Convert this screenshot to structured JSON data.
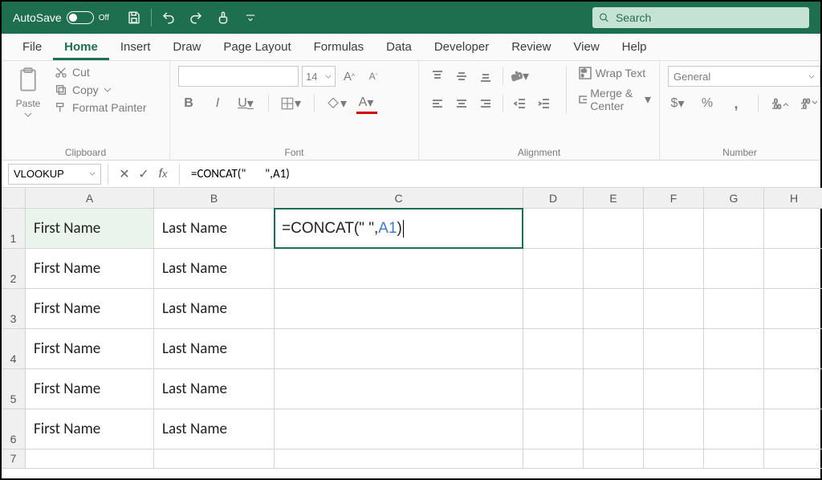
{
  "titlebar": {
    "autosave": "AutoSave",
    "toggle": "Off"
  },
  "search": {
    "placeholder": "Search"
  },
  "tabs": [
    "File",
    "Home",
    "Insert",
    "Draw",
    "Page Layout",
    "Formulas",
    "Data",
    "Developer",
    "Review",
    "View",
    "Help"
  ],
  "active_tab": "Home",
  "ribbon": {
    "clipboard": {
      "label": "Clipboard",
      "paste": "Paste",
      "cut": "Cut",
      "copy": "Copy",
      "format_painter": "Format Painter"
    },
    "font": {
      "label": "Font",
      "font_name": "",
      "font_size": "14",
      "bold": "B",
      "italic": "I",
      "underline": "U"
    },
    "alignment": {
      "label": "Alignment",
      "wrap": "Wrap Text",
      "merge": "Merge & Center"
    },
    "number": {
      "label": "Number",
      "format": "General"
    }
  },
  "formula_bar": {
    "name_box": "VLOOKUP",
    "formula": "=CONCAT(\"       \",A1)"
  },
  "grid": {
    "columns": [
      "A",
      "B",
      "C",
      "D",
      "E",
      "F",
      "G",
      "H"
    ],
    "rows": [
      {
        "n": "1",
        "A": "First Name",
        "B": "Last Name",
        "C_formula": {
          "pre": "=CONCAT(\"       \",",
          "ref": "A1",
          "post": ")"
        }
      },
      {
        "n": "2",
        "A": "First Name",
        "B": "Last Name"
      },
      {
        "n": "3",
        "A": "First Name",
        "B": "Last Name"
      },
      {
        "n": "4",
        "A": "First Name",
        "B": "Last Name"
      },
      {
        "n": "5",
        "A": "First Name",
        "B": "Last Name"
      },
      {
        "n": "6",
        "A": "First Name",
        "B": "Last Name"
      },
      {
        "n": "7",
        "A": "",
        "B": ""
      }
    ]
  }
}
